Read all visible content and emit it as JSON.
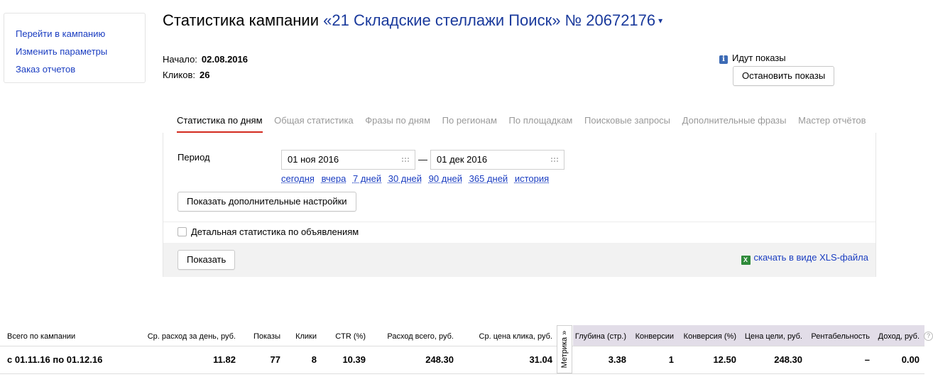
{
  "sidebar": {
    "links": [
      "Перейти в кампанию",
      "Изменить параметры",
      "Заказ отчетов"
    ]
  },
  "header": {
    "title_prefix": "Статистика кампании",
    "campaign": "«21 Складские стеллажи Поиск» № 20672176",
    "dropdown_arrow": "▾"
  },
  "meta": {
    "start_label": "Начало:",
    "start_value": "02.08.2016",
    "clicks_label": "Кликов:",
    "clicks_value": "26"
  },
  "status": {
    "icon": "i",
    "text": "Идут показы",
    "stop_button": "Остановить показы"
  },
  "tabs": [
    {
      "label": "Статистика по дням",
      "active": true
    },
    {
      "label": "Общая статистика"
    },
    {
      "label": "Фразы по дням"
    },
    {
      "label": "По регионам"
    },
    {
      "label": "По площадкам"
    },
    {
      "label": "Поисковые запросы"
    },
    {
      "label": "Дополнительные фразы"
    },
    {
      "label": "Мастер отчётов"
    }
  ],
  "filter": {
    "period_label": "Период",
    "date_from": "01 ноя 2016",
    "date_to": "01 дек 2016",
    "dash": "—",
    "quick_ranges": [
      "сегодня",
      "вчера",
      "7 дней",
      "30 дней",
      "90 дней",
      "365 дней",
      "история"
    ],
    "more_settings_button": "Показать дополнительные настройки",
    "detail_checkbox_label": "Детальная статистика по объявлениям",
    "detail_checked": false,
    "show_button": "Показать",
    "xls_icon": "X",
    "xls_link": "скачать в виде XLS-файла"
  },
  "stats": {
    "headers": {
      "total": "Всего по кампании",
      "avg_daily": "Ср. расход за день, руб.",
      "impressions": "Показы",
      "clicks": "Клики",
      "ctr": "CTR (%)",
      "total_spend": "Расход всего, руб.",
      "avg_cpc": "Ср. цена клика, руб.",
      "depth": "Глубина (стр.)",
      "conversions": "Конверсии",
      "conv_rate": "Конверсия (%)",
      "goal_price": "Цена цели, руб.",
      "profitability": "Рентабельность",
      "income": "Доход, руб."
    },
    "metrika_tab": "Метрика »",
    "help_icon": "?",
    "row": {
      "period": "с 01.11.16 по 01.12.16",
      "avg_daily": "11.82",
      "impressions": "77",
      "clicks": "8",
      "ctr": "10.39",
      "total_spend": "248.30",
      "avg_cpc": "31.04",
      "depth": "3.38",
      "conversions": "1",
      "conv_rate": "12.50",
      "goal_price": "248.30",
      "profitability": "–",
      "income": "0.00"
    }
  }
}
